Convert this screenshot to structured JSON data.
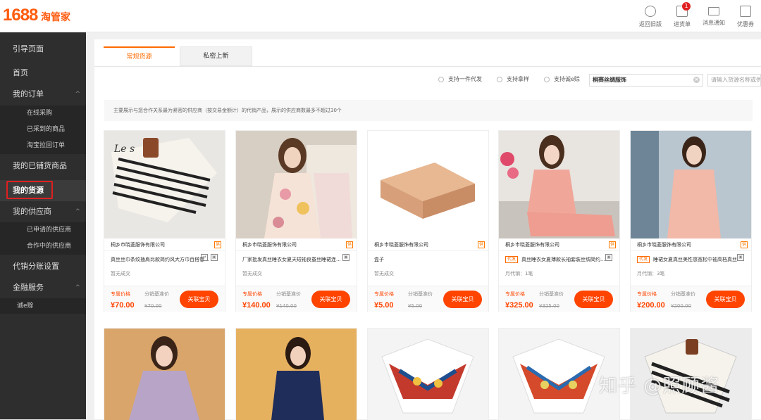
{
  "header": {
    "logo": "1688",
    "logo_sub": "淘管家",
    "actions": [
      {
        "label": "返回旧版",
        "icon": "back-circle-icon"
      },
      {
        "label": "进货单",
        "icon": "cart-icon",
        "badge": "1"
      },
      {
        "label": "消息通知",
        "icon": "mail-icon"
      },
      {
        "label": "优惠券",
        "icon": "coupon-icon"
      }
    ]
  },
  "sidebar": {
    "items": [
      {
        "label": "引导页面"
      },
      {
        "label": "首页"
      },
      {
        "label": "我的订单",
        "chevron": "^"
      },
      {
        "label": "在线采购"
      },
      {
        "label": "已采到的商品"
      },
      {
        "label": "淘宝拉回订单"
      },
      {
        "label": "我的已铺货商品"
      },
      {
        "label": "我的货源"
      },
      {
        "label": "我的供应商",
        "chevron": "^"
      },
      {
        "label": "已申请的供应商"
      },
      {
        "label": "合作中的供应商"
      },
      {
        "label": "代销分账设置"
      },
      {
        "label": "金融服务",
        "chevron": "^"
      },
      {
        "label": "诚e赊"
      }
    ]
  },
  "main": {
    "tabs": [
      {
        "label": "常规货源"
      },
      {
        "label": "私密上新"
      }
    ],
    "filters": [
      {
        "label": "支持一件代发"
      },
      {
        "label": "支持拿样"
      },
      {
        "label": "支持诚e赊"
      }
    ],
    "search_value": "桐赛丝绸服饰",
    "search_placeholder": "请输入货源名称或供应商",
    "notice": "主要展示与您合作关系最为紧密的供应商（按交易金额计）的代销产品，展示的供应商数最多不超过30个",
    "products": [
      {
        "supplier": "桐乡市晓菱服饰有限公司",
        "title": "真丝丝巾条纹插肩比款简约风大方巾百搭春...",
        "sold": "暂无成交",
        "price_label": "专属价格",
        "ref_label": "分销基准价",
        "price": "¥70.00",
        "ref_price": "¥70.00",
        "btn": "关联宝贝",
        "badge": ""
      },
      {
        "supplier": "桐乡市晓菱服饰有限公司",
        "title": "厂家批发真丝睡衣女夏天短袖良蚕丝睡裙连...",
        "sold": "暂无成交",
        "price_label": "专属价格",
        "ref_label": "分销基准价",
        "price": "¥140.00",
        "ref_price": "¥140.00",
        "btn": "关联宝贝",
        "badge": ""
      },
      {
        "supplier": "桐乡市晓菱服饰有限公司",
        "title": "盒子",
        "sold": "暂无成交",
        "price_label": "专属价格",
        "ref_label": "分销基准价",
        "price": "¥5.00",
        "ref_price": "¥5.00",
        "btn": "关联宝贝",
        "badge": ""
      },
      {
        "supplier": "桐乡市晓菱服饰有限公司",
        "title": "真丝睡衣女夏薄款长袖套装丝绸简约...",
        "sold": "月代销：1笔",
        "price_label": "专属价格",
        "ref_label": "分销基准价",
        "price": "¥325.00",
        "ref_price": "¥325.00",
        "btn": "关联宝贝",
        "badge": "代发"
      },
      {
        "supplier": "桐乡市晓菱服饰有限公司",
        "title": "睡裙女夏真丝美性感宽松中袖高档真丝...",
        "sold": "月代销：3笔",
        "price_label": "专属价格",
        "ref_label": "分销基准价",
        "price": "¥200.00",
        "ref_price": "¥200.00",
        "btn": "关联宝贝",
        "badge": "代发"
      }
    ]
  },
  "watermark": "知乎 @照顾酱",
  "colors": {
    "accent": "#ff6a00",
    "button": "#ff4400",
    "price": "#ff4500",
    "sidebar": "#2e2e2e"
  }
}
